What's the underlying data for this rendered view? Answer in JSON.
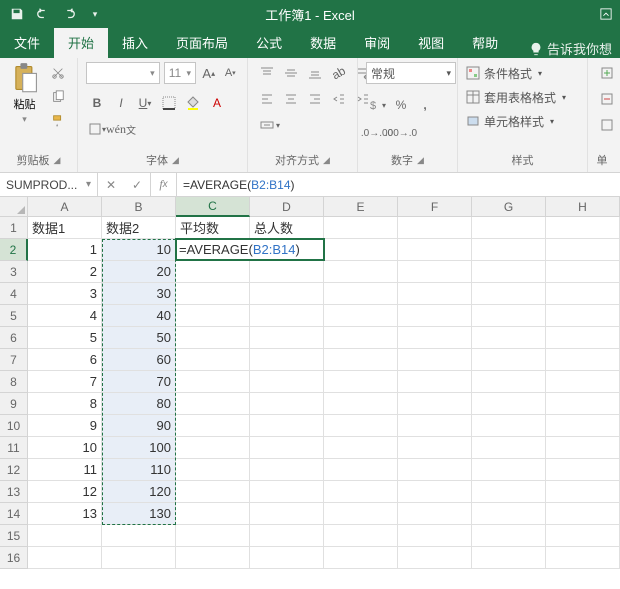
{
  "app": {
    "title": "工作簿1 - Excel"
  },
  "tabs": {
    "file": "文件",
    "home": "开始",
    "insert": "插入",
    "page_layout": "页面布局",
    "formulas": "公式",
    "data": "数据",
    "review": "审阅",
    "view": "视图",
    "help": "帮助",
    "tell_me": "告诉我你想"
  },
  "ribbon": {
    "clipboard": {
      "paste": "粘贴",
      "label": "剪贴板"
    },
    "font": {
      "name_placeholder": "",
      "size_placeholder": "11",
      "label": "字体"
    },
    "alignment": {
      "label": "对齐方式"
    },
    "number": {
      "format": "常规",
      "label": "数字"
    },
    "styles": {
      "cond": "条件格式",
      "table": "套用表格格式",
      "cell": "单元格样式",
      "label": "样式"
    },
    "cells": {
      "label": "单"
    }
  },
  "namebox": "SUMPROD...",
  "formula_bar": {
    "prefix": "=AVERAGE(",
    "ref": "B2:B14",
    "suffix": ")"
  },
  "columns": [
    "A",
    "B",
    "C",
    "D",
    "E",
    "F",
    "G",
    "H"
  ],
  "rows": [
    "1",
    "2",
    "3",
    "4",
    "5",
    "6",
    "7",
    "8",
    "9",
    "10",
    "11",
    "12",
    "13",
    "14",
    "15",
    "16"
  ],
  "header_row": {
    "A": "数据1",
    "B": "数据2",
    "C": "平均数",
    "D": "总人数"
  },
  "data_rows": [
    {
      "A": "1",
      "B": "10"
    },
    {
      "A": "2",
      "B": "20"
    },
    {
      "A": "3",
      "B": "30"
    },
    {
      "A": "4",
      "B": "40"
    },
    {
      "A": "5",
      "B": "50"
    },
    {
      "A": "6",
      "B": "60"
    },
    {
      "A": "7",
      "B": "70"
    },
    {
      "A": "8",
      "B": "80"
    },
    {
      "A": "9",
      "B": "90"
    },
    {
      "A": "10",
      "B": "100"
    },
    {
      "A": "11",
      "B": "110"
    },
    {
      "A": "12",
      "B": "120"
    },
    {
      "A": "13",
      "B": "130"
    }
  ],
  "editing_cell": {
    "prefix": "=AVERAGE(",
    "ref": "B2:B14",
    "suffix": ")"
  },
  "colors": {
    "accent": "#217346"
  }
}
